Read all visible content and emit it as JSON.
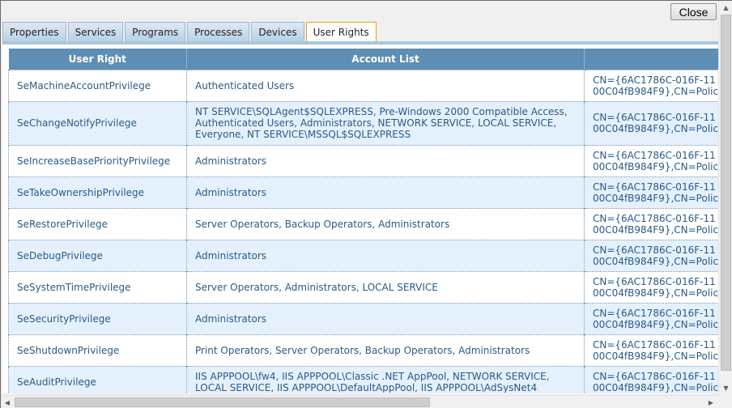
{
  "close_label": "Close",
  "tabs": [
    {
      "label": "Properties"
    },
    {
      "label": "Services"
    },
    {
      "label": "Programs"
    },
    {
      "label": "Processes"
    },
    {
      "label": "Devices"
    },
    {
      "label": "User Rights",
      "active": true
    }
  ],
  "table": {
    "headers": [
      "User Right",
      "Account List",
      ""
    ],
    "rows": [
      {
        "right": "SeMachineAccountPrivilege",
        "accounts": "Authenticated Users",
        "dn1": "CN={6AC1786C-016F-11",
        "dn2": "00C04fB984F9},CN=Polic"
      },
      {
        "right": "SeChangeNotifyPrivilege",
        "accounts": "NT SERVICE\\SQLAgent$SQLEXPRESS, Pre-Windows 2000 Compatible Access, Authenticated Users, Administrators, NETWORK SERVICE, LOCAL SERVICE, Everyone, NT SERVICE\\MSSQL$SQLEXPRESS",
        "dn1": "CN={6AC1786C-016F-11",
        "dn2": "00C04fB984F9},CN=Polic"
      },
      {
        "right": "SeIncreaseBasePriorityPrivilege",
        "accounts": "Administrators",
        "dn1": "CN={6AC1786C-016F-11",
        "dn2": "00C04fB984F9},CN=Polic"
      },
      {
        "right": "SeTakeOwnershipPrivilege",
        "accounts": "Administrators",
        "dn1": "CN={6AC1786C-016F-11",
        "dn2": "00C04fB984F9},CN=Polic"
      },
      {
        "right": "SeRestorePrivilege",
        "accounts": "Server Operators, Backup Operators, Administrators",
        "dn1": "CN={6AC1786C-016F-11",
        "dn2": "00C04fB984F9},CN=Polic"
      },
      {
        "right": "SeDebugPrivilege",
        "accounts": "Administrators",
        "dn1": "CN={6AC1786C-016F-11",
        "dn2": "00C04fB984F9},CN=Polic"
      },
      {
        "right": "SeSystemTimePrivilege",
        "accounts": "Server Operators, Administrators, LOCAL SERVICE",
        "dn1": "CN={6AC1786C-016F-11",
        "dn2": "00C04fB984F9},CN=Polic"
      },
      {
        "right": "SeSecurityPrivilege",
        "accounts": "Administrators",
        "dn1": "CN={6AC1786C-016F-11",
        "dn2": "00C04fB984F9},CN=Polic"
      },
      {
        "right": "SeShutdownPrivilege",
        "accounts": "Print Operators, Server Operators, Backup Operators, Administrators",
        "dn1": "CN={6AC1786C-016F-11",
        "dn2": "00C04fB984F9},CN=Polic"
      },
      {
        "right": "SeAuditPrivilege",
        "accounts": "IIS APPPOOL\\fw4, IIS APPPOOL\\Classic .NET AppPool, NETWORK SERVICE, LOCAL SERVICE, IIS APPPOOL\\DefaultAppPool, IIS APPPOOL\\AdSysNet4",
        "dn1": "CN={6AC1786C-016F-11",
        "dn2": "00C04fB984F9},CN=Polic"
      }
    ]
  },
  "scrollbars": {
    "vertical_up_icon": "arrow-up-icon",
    "vertical_down_icon": "arrow-down-icon",
    "horizontal_left_icon": "arrow-left-icon",
    "horizontal_right_icon": "arrow-right-icon"
  }
}
